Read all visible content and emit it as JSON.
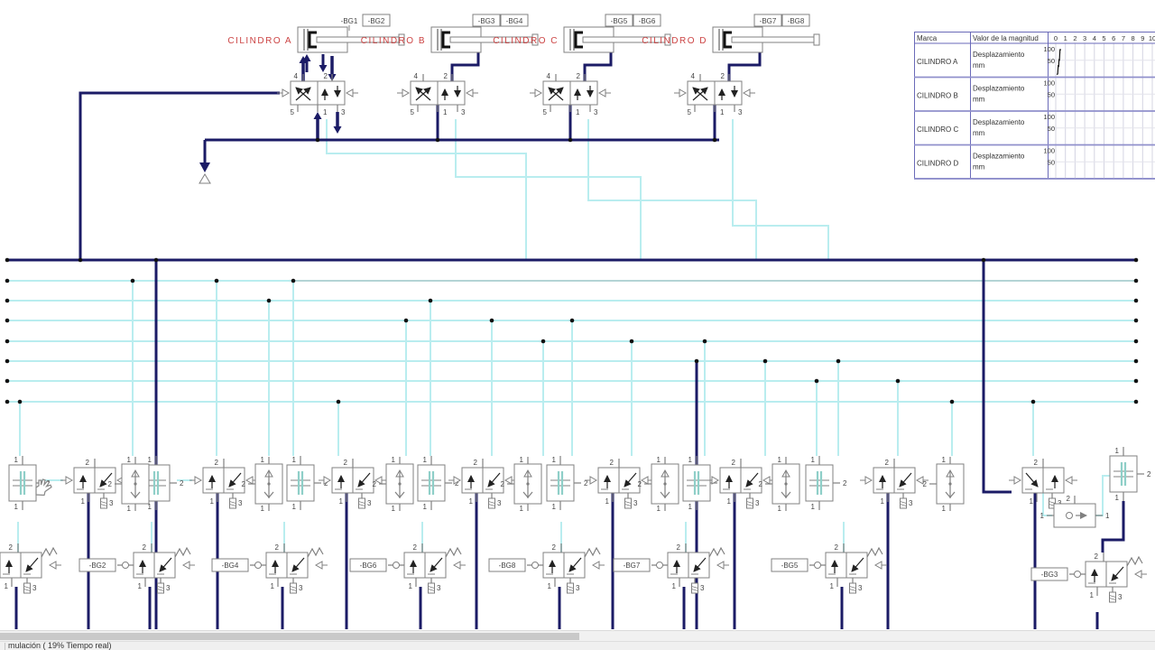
{
  "app": {
    "status_text": "mulación ( 19% Tiempo real)"
  },
  "colors": {
    "navy": "#1b1b66",
    "cyan": "#b9edef",
    "symbol": "#808080",
    "dark": "#222222",
    "red": "#cc4444",
    "teal": "#8fcfc8",
    "label": "#444444",
    "table_border": "#6a6ab8",
    "row_sep": "#9090cc",
    "grid": "#d4d4e2",
    "grid_light": "#e4e4ec",
    "curve": "#111111"
  },
  "cylinders": [
    {
      "label": "CILINDRO  A",
      "sensor_left": "-BG1",
      "sensor_right": "-BG2"
    },
    {
      "label": "CILINDRO  B",
      "sensor_left": "-BG3",
      "sensor_right": "-BG4"
    },
    {
      "label": "CILINDRO  C",
      "sensor_left": "-BG5",
      "sensor_right": "-BG6"
    },
    {
      "label": "CILINDRO  D",
      "sensor_left": "-BG7",
      "sensor_right": "-BG8"
    }
  ],
  "ports": {
    "five_two": [
      "4",
      "2",
      "5",
      "1",
      "3"
    ],
    "three_two": [
      "2",
      "1",
      "3"
    ],
    "two_port_top": "1",
    "two_port_bottom": "1",
    "two_port_side": "2"
  },
  "limit_valves": [
    "",
    "-BG2",
    "-BG4",
    "-BG6",
    "-BG8",
    "-BG7",
    "-BG5",
    "-BG3"
  ],
  "chart_data": {
    "type": "line",
    "columns": [
      "Marca",
      "Valor de la magnitud"
    ],
    "xticks": [
      "0",
      "1",
      "2",
      "3",
      "4",
      "5",
      "6",
      "7",
      "8",
      "9",
      "10"
    ],
    "ylim": [
      0,
      100
    ],
    "yticks": [
      "100",
      "50"
    ],
    "legend_position": "left-table",
    "grid": true,
    "panels": [
      {
        "marca": "CILINDRO A",
        "magnitud": "Desplazamiento",
        "unit": "mm",
        "series": [
          [
            0.1,
            0
          ],
          [
            0.2,
            2
          ],
          [
            0.26,
            38
          ],
          [
            0.3,
            30
          ],
          [
            0.34,
            62
          ],
          [
            0.38,
            55
          ],
          [
            0.44,
            100
          ],
          [
            0.55,
            100
          ]
        ]
      },
      {
        "marca": "CILINDRO B",
        "magnitud": "Desplazamiento",
        "unit": "mm",
        "series": []
      },
      {
        "marca": "CILINDRO C",
        "magnitud": "Desplazamiento",
        "unit": "mm",
        "series": []
      },
      {
        "marca": "CILINDRO D",
        "magnitud": "Desplazamiento",
        "unit": "mm",
        "series": []
      }
    ]
  }
}
